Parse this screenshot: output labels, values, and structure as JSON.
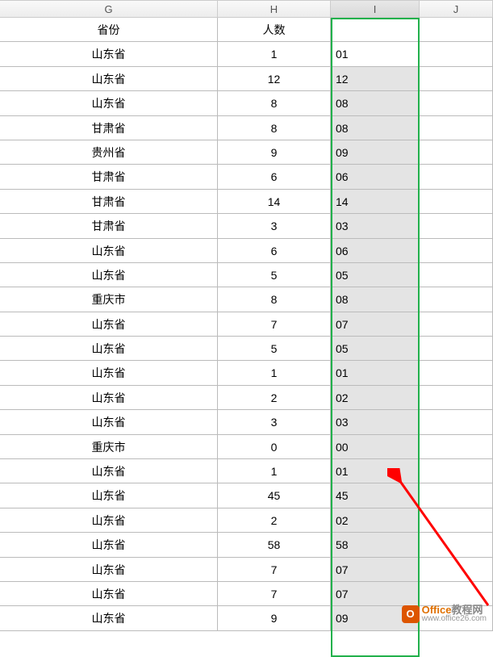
{
  "columns": {
    "g_label": "G",
    "h_label": "H",
    "i_label": "I",
    "j_label": "J"
  },
  "header_row": {
    "province": "省份",
    "count": "人数",
    "formatted": ""
  },
  "rows": [
    {
      "province": "山东省",
      "count": "1",
      "formatted": "01"
    },
    {
      "province": "山东省",
      "count": "12",
      "formatted": "12"
    },
    {
      "province": "山东省",
      "count": "8",
      "formatted": "08"
    },
    {
      "province": "甘肃省",
      "count": "8",
      "formatted": "08"
    },
    {
      "province": "贵州省",
      "count": "9",
      "formatted": "09"
    },
    {
      "province": "甘肃省",
      "count": "6",
      "formatted": "06"
    },
    {
      "province": "甘肃省",
      "count": "14",
      "formatted": "14"
    },
    {
      "province": "甘肃省",
      "count": "3",
      "formatted": "03"
    },
    {
      "province": "山东省",
      "count": "6",
      "formatted": "06"
    },
    {
      "province": "山东省",
      "count": "5",
      "formatted": "05"
    },
    {
      "province": "重庆市",
      "count": "8",
      "formatted": "08"
    },
    {
      "province": "山东省",
      "count": "7",
      "formatted": "07"
    },
    {
      "province": "山东省",
      "count": "5",
      "formatted": "05"
    },
    {
      "province": "山东省",
      "count": "1",
      "formatted": "01"
    },
    {
      "province": "山东省",
      "count": "2",
      "formatted": "02"
    },
    {
      "province": "山东省",
      "count": "3",
      "formatted": "03"
    },
    {
      "province": "重庆市",
      "count": "0",
      "formatted": "00"
    },
    {
      "province": "山东省",
      "count": "1",
      "formatted": "01"
    },
    {
      "province": "山东省",
      "count": "45",
      "formatted": "45"
    },
    {
      "province": "山东省",
      "count": "2",
      "formatted": "02"
    },
    {
      "province": "山东省",
      "count": "58",
      "formatted": "58"
    },
    {
      "province": "山东省",
      "count": "7",
      "formatted": "07"
    },
    {
      "province": "山东省",
      "count": "7",
      "formatted": "07"
    },
    {
      "province": "山东省",
      "count": "9",
      "formatted": "09"
    }
  ],
  "watermark": {
    "brand_left": "Office",
    "brand_right": "教程网",
    "url": "www.office26.com",
    "icon_letter": "O"
  }
}
